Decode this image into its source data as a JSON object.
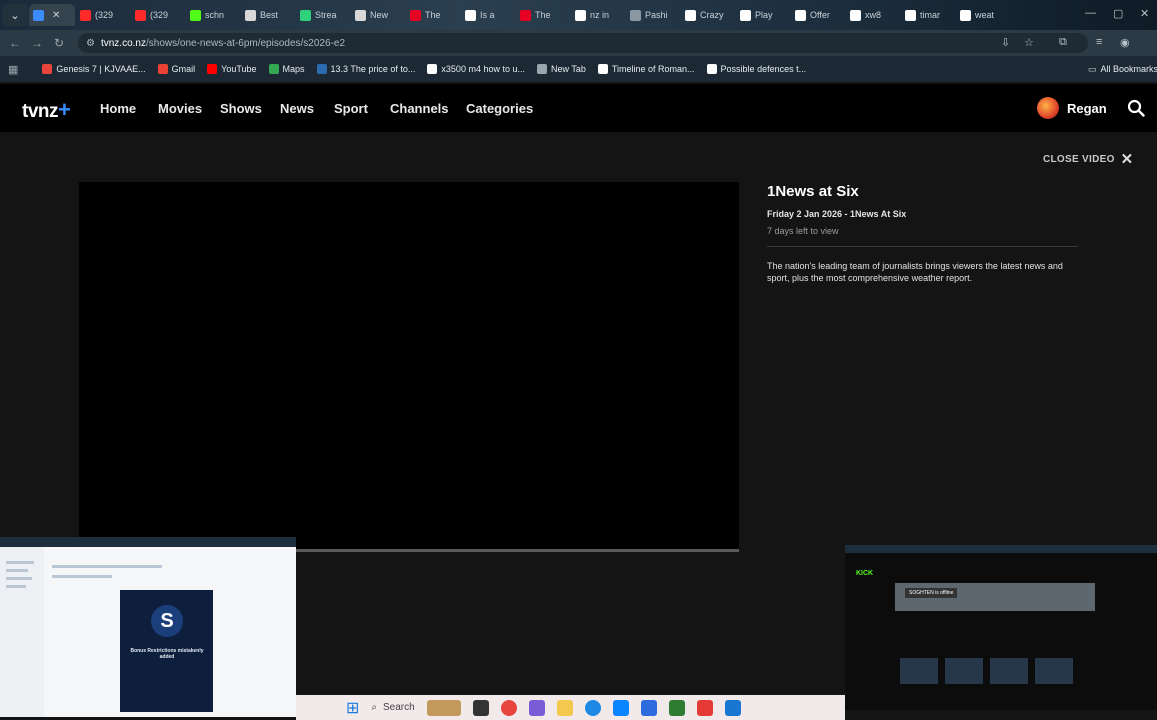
{
  "browser": {
    "tabs": [
      {
        "title": "",
        "icon": "plus-icon",
        "color": "#3b8cff"
      },
      {
        "title": "(329",
        "icon": "youtube-icon",
        "color": "#ff2a2a"
      },
      {
        "title": "(329",
        "icon": "youtube-icon",
        "color": "#ff2a2a"
      },
      {
        "title": "schn",
        "icon": "kick-icon",
        "color": "#53fc18"
      },
      {
        "title": "Best",
        "icon": "doc-icon",
        "color": "#d9d9d9"
      },
      {
        "title": "Strea",
        "icon": "stream-icon",
        "color": "#2fd17a"
      },
      {
        "title": "New",
        "icon": "doc-icon",
        "color": "#d9d9d9"
      },
      {
        "title": "The",
        "icon": "pinterest-icon",
        "color": "#e60023"
      },
      {
        "title": "Is a",
        "icon": "google-icon",
        "color": "#ffffff"
      },
      {
        "title": "The",
        "icon": "pinterest-icon",
        "color": "#e60023"
      },
      {
        "title": "nz in",
        "icon": "google-icon",
        "color": "#ffffff"
      },
      {
        "title": "Pashi",
        "icon": "blank-icon",
        "color": "#8a98a3"
      },
      {
        "title": "Crazy",
        "icon": "s-icon",
        "color": "#ffffff"
      },
      {
        "title": "Play",
        "icon": "s-icon",
        "color": "#ffffff"
      },
      {
        "title": "Offer",
        "icon": "s-icon",
        "color": "#ffffff"
      },
      {
        "title": "xw8",
        "icon": "google-icon",
        "color": "#ffffff"
      },
      {
        "title": "timar",
        "icon": "google-icon",
        "color": "#ffffff"
      },
      {
        "title": "weat",
        "icon": "google-icon",
        "color": "#ffffff"
      }
    ],
    "url_host": "tvnz.co.nz",
    "url_path": "/shows/one-news-at-6pm/episodes/s2026-e2",
    "bookmarks": [
      {
        "label": "Genesis 7 | KJVAAE...",
        "color": "#e8453c"
      },
      {
        "label": "Gmail",
        "color": "#ea4335"
      },
      {
        "label": "YouTube",
        "color": "#ff0000"
      },
      {
        "label": "Maps",
        "color": "#34a853"
      },
      {
        "label": "13.3 The price of to...",
        "color": "#2b6cb0"
      },
      {
        "label": "x3500 m4 how to u...",
        "color": "#ffffff"
      },
      {
        "label": "New Tab",
        "color": "#9aa6ae"
      },
      {
        "label": "Timeline of Roman...",
        "color": "#ffffff"
      },
      {
        "label": "Possible defences t...",
        "color": "#ffffff"
      }
    ],
    "all_bookmarks": "All Bookmarks"
  },
  "site": {
    "logo": "tvnz",
    "logo_plus": "+",
    "nav": [
      "Home",
      "Movies",
      "Shows",
      "News",
      "Sport",
      "Channels",
      "Categories"
    ],
    "user_name": "Regan",
    "close_video": "CLOSE VIDEO",
    "episode": {
      "title": "1News at Six",
      "date_line": "Friday 2 Jan 2026 - 1News At Six",
      "days_left": "7 days left to view",
      "description": "The nation's leading team of journalists brings viewers the latest news and sport, plus the most comprehensive weather report."
    }
  },
  "overlays": {
    "left_card_letter": "S",
    "left_card_text": "Bonus Restrictions mistakenly added",
    "right_logo": "KICK",
    "right_offline": "SOGHTEN is offline"
  },
  "taskbar": {
    "search_label": "Search"
  }
}
